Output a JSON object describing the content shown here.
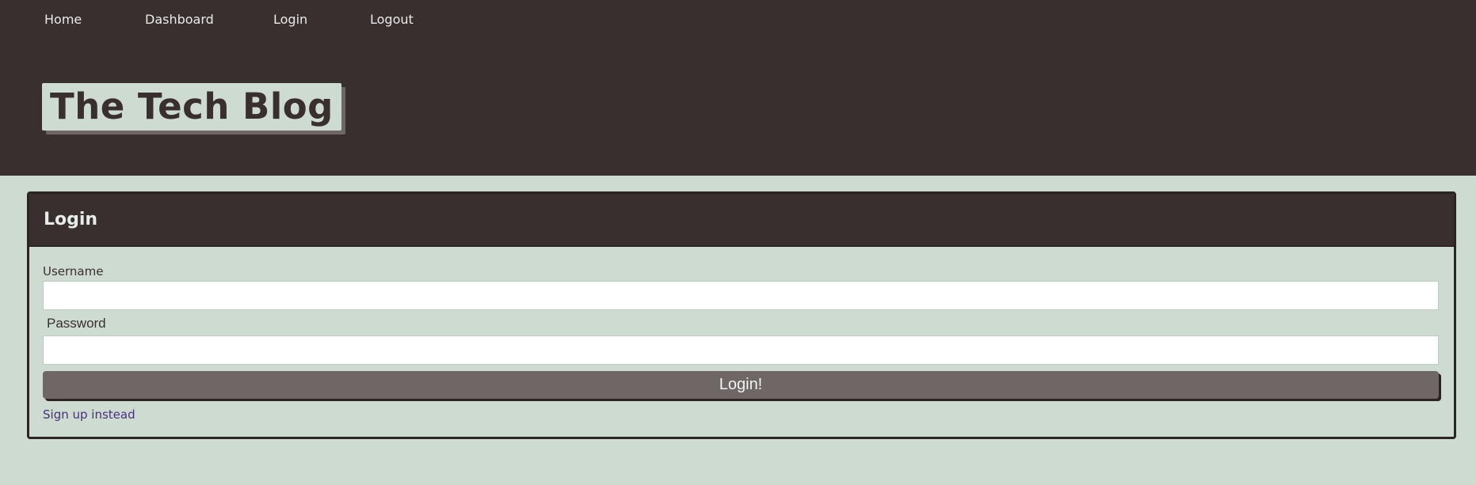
{
  "nav": {
    "items": [
      {
        "label": "Home"
      },
      {
        "label": "Dashboard"
      },
      {
        "label": "Login"
      },
      {
        "label": "Logout"
      }
    ]
  },
  "site": {
    "title": "The Tech Blog"
  },
  "login_card": {
    "heading": "Login",
    "username_label": "Username",
    "username_value": "",
    "password_label": "Password",
    "password_value": "",
    "submit_label": "Login!",
    "signup_link": "Sign up instead"
  },
  "colors": {
    "header_bg": "#3a2f2f",
    "page_bg": "#cddbd1",
    "button_bg": "#6f6666",
    "link": "#4a2e80"
  }
}
